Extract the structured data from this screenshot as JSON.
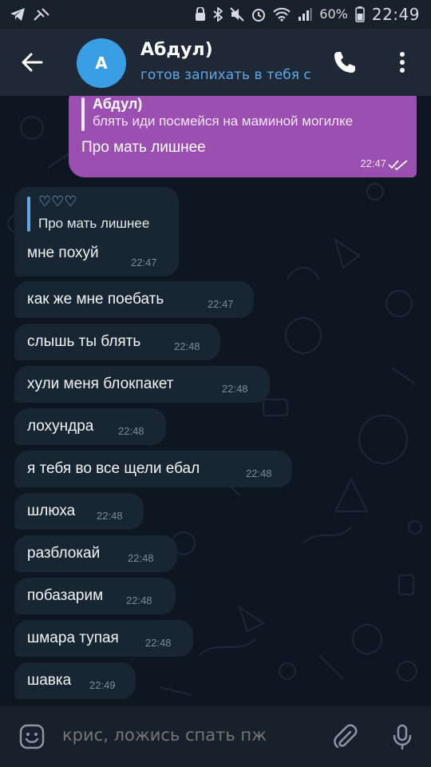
{
  "status_bar": {
    "battery": "60%",
    "time": "22:49",
    "left_icons": [
      "telegram-icon",
      "mute-wrench-icon"
    ],
    "right_icons": [
      "lock-icon",
      "bluetooth-icon",
      "mute-icon",
      "alarm-icon",
      "wifi-icon",
      "signal-icon",
      "battery-icon"
    ]
  },
  "header": {
    "avatar_letter": "А",
    "title": "Абдул)",
    "subtitle": "готов запихать в тебя с",
    "icons": [
      "back-arrow-icon",
      "phone-icon",
      "more-vert-icon"
    ],
    "avatar_color": "#3a9ee4"
  },
  "chat": {
    "outgoing": {
      "reply_name": "Абдул)",
      "reply_text": "блять иди посмейся на маминой могилке",
      "text": "Про мать лишнее",
      "time": "22:47",
      "status": "read",
      "color": "#9b4fb0"
    },
    "first_incoming": {
      "reply_name": "♡♡♡",
      "reply_text": "Про мать лишнее",
      "text": "мне похуй",
      "time": "22:47"
    },
    "messages": [
      {
        "text": "как же мне поебать",
        "time": "22:47"
      },
      {
        "text": "слышь ты блять",
        "time": "22:48"
      },
      {
        "text": "хули меня блокпакет",
        "time": "22:48"
      },
      {
        "text": "лохундра",
        "time": "22:48"
      },
      {
        "text": "я тебя во все щели ебал",
        "time": "22:48"
      },
      {
        "text": "шлюха",
        "time": "22:48"
      },
      {
        "text": "разблокай",
        "time": "22:48"
      },
      {
        "text": "побазарим",
        "time": "22:48"
      },
      {
        "text": "шмара тупая",
        "time": "22:48"
      },
      {
        "text": "шавка",
        "time": "22:49"
      }
    ]
  },
  "composer": {
    "placeholder": "крис, ложись спать пж",
    "icons": [
      "emoji-icon",
      "attach-icon",
      "mic-icon"
    ]
  }
}
